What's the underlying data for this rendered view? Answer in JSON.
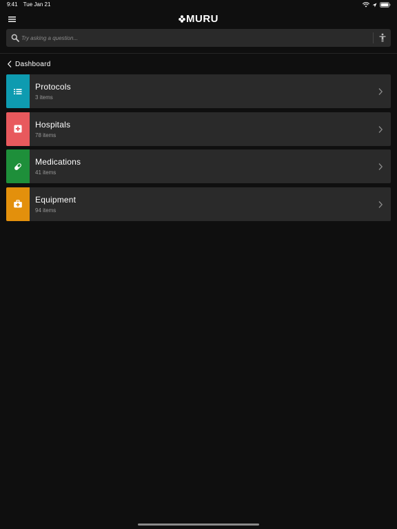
{
  "status_bar": {
    "time": "9:41",
    "date": "Tue Jan 21"
  },
  "header": {
    "logo_text": "MURU"
  },
  "search": {
    "placeholder": "Try asking a question..."
  },
  "breadcrumb": {
    "label": "Dashboard"
  },
  "categories": [
    {
      "title": "Protocols",
      "count": "3 items",
      "color": "#0e9bb0",
      "icon": "list-icon"
    },
    {
      "title": "Hospitals",
      "count": "78 items",
      "color": "#e8595d",
      "icon": "hospital-cross-icon"
    },
    {
      "title": "Medications",
      "count": "41 items",
      "color": "#1e8f3a",
      "icon": "pill-icon"
    },
    {
      "title": "Equipment",
      "count": "94 items",
      "color": "#e3900c",
      "icon": "medical-bag-icon"
    }
  ]
}
